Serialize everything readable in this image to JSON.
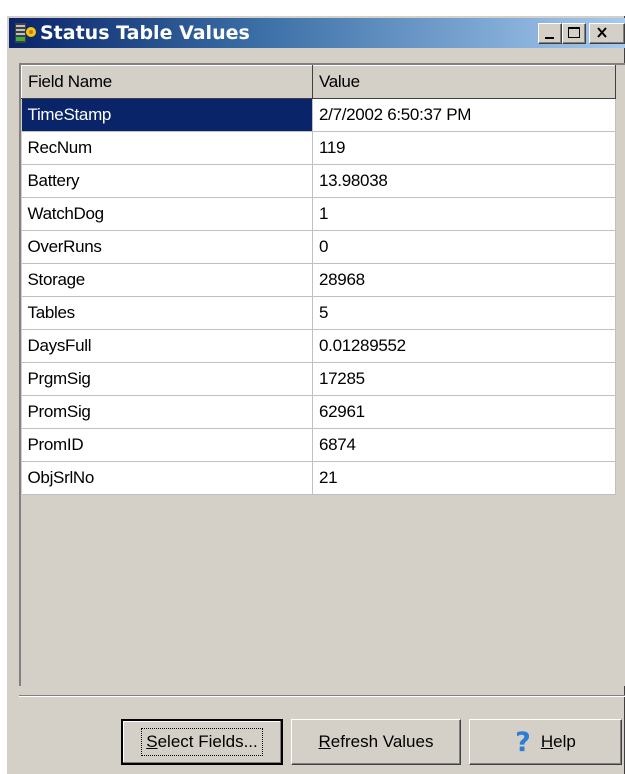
{
  "window": {
    "title": "Status Table Values"
  },
  "grid": {
    "columns": [
      "Field Name",
      "Value"
    ],
    "selected_row": 0,
    "rows": [
      {
        "name": "TimeStamp",
        "value": "2/7/2002 6:50:37 PM"
      },
      {
        "name": "RecNum",
        "value": "119"
      },
      {
        "name": "Battery",
        "value": "13.98038"
      },
      {
        "name": "WatchDog",
        "value": "1"
      },
      {
        "name": "OverRuns",
        "value": "0"
      },
      {
        "name": "Storage",
        "value": "28968"
      },
      {
        "name": "Tables",
        "value": "5"
      },
      {
        "name": "DaysFull",
        "value": "0.01289552"
      },
      {
        "name": "PrgmSig",
        "value": "17285"
      },
      {
        "name": "PromSig",
        "value": "62961"
      },
      {
        "name": "PromID",
        "value": "6874"
      },
      {
        "name": "ObjSrlNo",
        "value": "21"
      }
    ]
  },
  "buttons": {
    "select_fields": {
      "hotkey": "S",
      "rest": "elect Fields..."
    },
    "refresh_values": {
      "hotkey": "R",
      "rest": "efresh Values"
    },
    "help": {
      "hotkey": "H",
      "rest": "elp",
      "icon": "help-question-icon"
    }
  },
  "colors": {
    "selection": "#0a246a",
    "titlebar_start": "#0a246a",
    "titlebar_end": "#a6caf0",
    "face": "#d4d0c8"
  }
}
